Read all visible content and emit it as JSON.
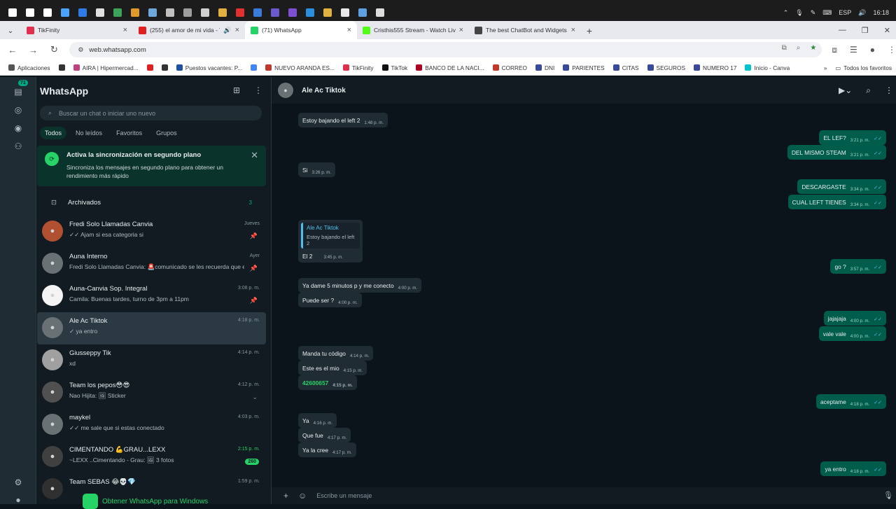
{
  "taskbar": {
    "icons": [
      "windows-icon",
      "search-icon",
      "task-view-icon",
      "copilot-icon",
      "store-icon",
      "app-icon",
      "app-icon",
      "app-icon",
      "app-icon",
      "app-icon",
      "app-icon",
      "app-icon",
      "app-icon",
      "youtube-icon",
      "app-icon",
      "app-icon",
      "visual-studio-icon",
      "vscode-icon",
      "folder-icon",
      "chrome-icon",
      "steam-icon",
      "clock-app-icon"
    ],
    "icon_colors": [
      "#ffffff",
      "#ffffff",
      "#ffffff",
      "#4aa3ff",
      "#2f7ae5",
      "#e0e0e0",
      "#3ca35a",
      "#e09a2a",
      "#6fa8dc",
      "#c0c0c0",
      "#9e9e9e",
      "#d0d0d0",
      "#e0b040",
      "#e23030",
      "#3a7ad8",
      "#6a5acd",
      "#7f4fd1",
      "#2b8fe0",
      "#e0b040",
      "#e8e8e8",
      "#5fa0e0",
      "#dddddd"
    ],
    "language": "ESP",
    "time": "16:18"
  },
  "tabs": [
    {
      "label": "TikFinity",
      "color": "#e03050"
    },
    {
      "label": "(255) el amor de mi vida - Y",
      "color": "#e02020"
    },
    {
      "label": "(71) WhatsApp",
      "color": "#25d366"
    },
    {
      "label": "Cristhis555 Stream - Watch Live",
      "color": "#53fc18"
    },
    {
      "label": "The best ChatBot and Widgets",
      "color": "#444444"
    }
  ],
  "address": {
    "url": "web.whatsapp.com"
  },
  "bookmarks": [
    {
      "label": "Aplicaciones",
      "color": "#555555"
    },
    {
      "label": "",
      "color": "#333333"
    },
    {
      "label": "AIRA | Hipermercad...",
      "color": "#c04080"
    },
    {
      "label": "",
      "color": "#e02020"
    },
    {
      "label": "",
      "color": "#333333"
    },
    {
      "label": "Puestos vacantes: P...",
      "color": "#2050a0"
    },
    {
      "label": "",
      "color": "#4285f4"
    },
    {
      "label": "NUEVO ARANDA ES...",
      "color": "#c0392b"
    },
    {
      "label": "TikFinity",
      "color": "#e03050"
    },
    {
      "label": "TikTok",
      "color": "#111111"
    },
    {
      "label": "BANCO DE LA NACI...",
      "color": "#b00020"
    },
    {
      "label": "CORREO",
      "color": "#c0392b"
    },
    {
      "label": "DNI",
      "color": "#3a4a9a"
    },
    {
      "label": "PARIENTES",
      "color": "#3a4a9a"
    },
    {
      "label": "CITAS",
      "color": "#3a4a9a"
    },
    {
      "label": "SEGUROS",
      "color": "#3a4a9a"
    },
    {
      "label": "NUMERO 17",
      "color": "#3a4a9a"
    },
    {
      "label": "Inicio - Canva",
      "color": "#00c4cc"
    }
  ],
  "bookmarks_more": "Todos los favoritos",
  "rail": {
    "badge": "71"
  },
  "sidebar": {
    "title": "WhatsApp",
    "search_placeholder": "Buscar un chat o iniciar uno nuevo",
    "filters": [
      "Todos",
      "No leídos",
      "Favoritos",
      "Grupos"
    ],
    "banner": {
      "title": "Activa la sincronización en segundo plano",
      "text": "Sincroniza los mensajes en segundo plano para obtener un rendimiento más rápido"
    },
    "archived": {
      "label": "Archivados",
      "count": "3"
    },
    "chats": [
      {
        "name": "Fredi Solo Llamadas Canvia",
        "msg": "✓✓ Ajam si esa categoria si",
        "time": "Jueves",
        "pin": true,
        "badge": "",
        "selected": false,
        "avatar_color": "#b05030"
      },
      {
        "name": "Auna Interno",
        "msg": "Fredi Solo Llamadas Canvia: 🚨comunicado se les recuerda que e...",
        "time": "Ayer",
        "pin": true,
        "badge": "",
        "selected": false,
        "avatar_color": "#6a7175"
      },
      {
        "name": "Auna-Canvia Sop. Integral",
        "msg": "Camila: Buenas tardes, turno de 3pm a 11pm",
        "time": "3:08 p. m.",
        "pin": true,
        "badge": "",
        "selected": false,
        "avatar_color": "#f4f4f4"
      },
      {
        "name": "Ale Ac Tiktok",
        "msg": "✓ ya entro",
        "time": "4:18 p. m.",
        "pin": false,
        "badge": "",
        "selected": true,
        "avatar_color": "#6a7175"
      },
      {
        "name": "Giusseppy Tik",
        "msg": "xd",
        "time": "4:14 p. m.",
        "pin": false,
        "badge": "",
        "selected": false,
        "avatar_color": "#a0a0a0"
      },
      {
        "name": "Team los pepos😳😎",
        "msg": "Nao Hijita: 🖼 Sticker",
        "time": "4:12 p. m.",
        "pin": false,
        "badge": "",
        "selected": false,
        "avatar_color": "#505050"
      },
      {
        "name": "maykel",
        "msg": "✓✓ me sale que si estas conectado",
        "time": "4:03 p. m.",
        "pin": false,
        "badge": "",
        "selected": false,
        "avatar_color": "#6a7175"
      },
      {
        "name": "CIMENTANDO 💪GRAU...LEXX",
        "msg": "~LEXX ..Cimentando - Grau: 🖼 3 fotos",
        "time": "2:15 p. m.",
        "pin": false,
        "badge": "260",
        "selected": false,
        "avatar_color": "#404040"
      },
      {
        "name": "Team SEBAS 😂💀💎",
        "msg": "",
        "time": "1:59 p. m.",
        "pin": false,
        "badge": "",
        "selected": false,
        "avatar_color": "#303030"
      }
    ],
    "get_app": "Obtener WhatsApp para Windows"
  },
  "chat": {
    "contact": "Ale Ac Tiktok",
    "composer_placeholder": "Escribe un mensaje",
    "messages": [
      {
        "dir": "in",
        "text": "Estoy bajando el left 2",
        "time": "1:48 p. m."
      },
      {
        "dir": "out",
        "text": "EL LEF?",
        "time": "3:21 p. m."
      },
      {
        "dir": "out",
        "text": "DEL MISMO STEAM",
        "time": "3:21 p. m."
      },
      {
        "dir": "in",
        "text": "Si",
        "time": "3:26 p. m."
      },
      {
        "dir": "out",
        "text": "DESCARGASTE",
        "time": "3:34 p. m."
      },
      {
        "dir": "out",
        "text": "CUAL LEFT TIENES",
        "time": "3:34 p. m."
      },
      {
        "dir": "out",
        "text": "go ?",
        "time": "3:57 p. m."
      },
      {
        "dir": "in",
        "text": "Ya dame 5 minutos p y me conecto",
        "time": "4:00 p. m."
      },
      {
        "dir": "in",
        "text": "Puede ser ?",
        "time": "4:00 p. m."
      },
      {
        "dir": "out",
        "text": "jajajaja",
        "time": "4:00 p. m."
      },
      {
        "dir": "out",
        "text": "vale vale",
        "time": "4:00 p. m."
      },
      {
        "dir": "in",
        "text": "Manda tu código",
        "time": "4:14 p. m."
      },
      {
        "dir": "in",
        "text": "Este es el mio",
        "time": "4:15 p. m."
      },
      {
        "dir": "in",
        "text": "42600657",
        "time": "4:15 p. m."
      },
      {
        "dir": "out",
        "text": "aceptame",
        "time": "4:18 p. m."
      },
      {
        "dir": "in",
        "text": "Ya",
        "time": "4:16 p. m."
      },
      {
        "dir": "in",
        "text": "Que fue",
        "time": "4:17 p. m."
      },
      {
        "dir": "in",
        "text": "Ya la cree",
        "time": "4:17 p. m."
      },
      {
        "dir": "out",
        "text": "ya entro",
        "time": "4:18 p. m."
      }
    ],
    "reply": {
      "author": "Ale Ac Tiktok",
      "quoted": "Estoy bajando el left 2",
      "text": "El 2",
      "time": "3:45 p. m."
    }
  }
}
